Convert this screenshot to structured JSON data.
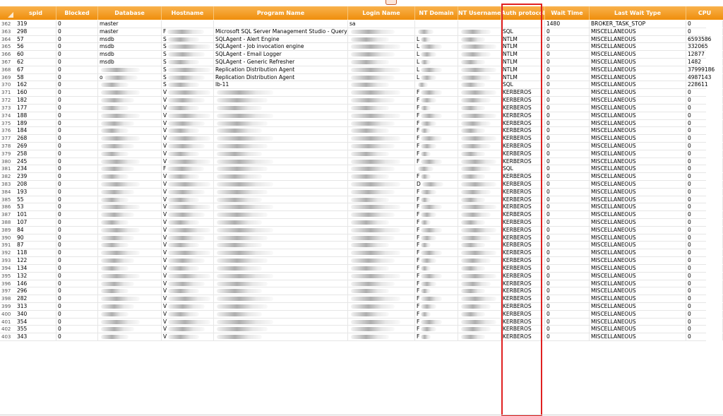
{
  "columns": [
    "spid",
    "Blocked",
    "Database",
    "Hostname",
    "Program Name",
    "Login Name",
    "NT Domain",
    "NT Username",
    "Auth protocol",
    "Wait Time",
    "Last Wait Type",
    "CPU"
  ],
  "rows": [
    {
      "n": "362",
      "spid": "319",
      "blocked": "0",
      "db": "master",
      "host": "",
      "prog": "",
      "login": "sa",
      "domain": "",
      "user": "",
      "auth": "",
      "wait": "1480",
      "wtype": "BROKER_TASK_STOP",
      "cpu": "0"
    },
    {
      "n": "363",
      "spid": "298",
      "blocked": "0",
      "db": "master",
      "host": "F",
      "prog": "Microsoft SQL Server Management Studio - Query",
      "login": "",
      "domain": "",
      "user": "",
      "auth": "SQL",
      "wait": "0",
      "wtype": "MISCELLANEOUS",
      "cpu": "0"
    },
    {
      "n": "364",
      "spid": "57",
      "blocked": "0",
      "db": "msdb",
      "host": "S",
      "prog": "SQLAgent - Alert Engine",
      "login": "",
      "domain": "L",
      "user": "",
      "auth": "NTLM",
      "wait": "0",
      "wtype": "MISCELLANEOUS",
      "cpu": "6593586"
    },
    {
      "n": "365",
      "spid": "56",
      "blocked": "0",
      "db": "msdb",
      "host": "S",
      "prog": "SQLAgent - Job invocation engine",
      "login": "",
      "domain": "L",
      "user": "",
      "auth": "NTLM",
      "wait": "0",
      "wtype": "MISCELLANEOUS",
      "cpu": "332065"
    },
    {
      "n": "366",
      "spid": "60",
      "blocked": "0",
      "db": "msdb",
      "host": "S",
      "prog": "SQLAgent - Email Logger",
      "login": "",
      "domain": "L",
      "user": "",
      "auth": "NTLM",
      "wait": "0",
      "wtype": "MISCELLANEOUS",
      "cpu": "12877"
    },
    {
      "n": "367",
      "spid": "62",
      "blocked": "0",
      "db": "msdb",
      "host": "S",
      "prog": "SQLAgent - Generic Refresher",
      "login": "",
      "domain": "L",
      "user": "",
      "auth": "NTLM",
      "wait": "0",
      "wtype": "MISCELLANEOUS",
      "cpu": "1482"
    },
    {
      "n": "368",
      "spid": "67",
      "blocked": "0",
      "db": "",
      "host": "S",
      "prog": "Replication Distribution Agent",
      "login": "",
      "domain": "L",
      "user": "",
      "auth": "NTLM",
      "wait": "0",
      "wtype": "MISCELLANEOUS",
      "cpu": "37999186"
    },
    {
      "n": "369",
      "spid": "58",
      "blocked": "0",
      "db": "o",
      "host": "S",
      "prog": "Replication Distribution Agent",
      "login": "",
      "domain": "L",
      "user": "",
      "auth": "NTLM",
      "wait": "0",
      "wtype": "MISCELLANEOUS",
      "cpu": "4987143"
    },
    {
      "n": "370",
      "spid": "162",
      "blocked": "0",
      "db": "",
      "host": "S",
      "prog": "Ib-11",
      "login": "",
      "domain": "",
      "user": "",
      "auth": "SQL",
      "wait": "0",
      "wtype": "MISCELLANEOUS",
      "cpu": "228611"
    },
    {
      "n": "371",
      "spid": "160",
      "blocked": "0",
      "db": "",
      "host": "V",
      "prog": "",
      "login": "",
      "domain": "F",
      "user": "",
      "auth": "KERBEROS",
      "wait": "0",
      "wtype": "MISCELLANEOUS",
      "cpu": "0"
    },
    {
      "n": "372",
      "spid": "182",
      "blocked": "0",
      "db": "",
      "host": "V",
      "prog": "",
      "login": "",
      "domain": "F",
      "user": "",
      "auth": "KERBEROS",
      "wait": "0",
      "wtype": "MISCELLANEOUS",
      "cpu": "0"
    },
    {
      "n": "373",
      "spid": "177",
      "blocked": "0",
      "db": "",
      "host": "V",
      "prog": "",
      "login": "",
      "domain": "F",
      "user": "",
      "auth": "KERBEROS",
      "wait": "0",
      "wtype": "MISCELLANEOUS",
      "cpu": "0"
    },
    {
      "n": "374",
      "spid": "188",
      "blocked": "0",
      "db": "",
      "host": "V",
      "prog": "",
      "login": "",
      "domain": "F",
      "user": "",
      "auth": "KERBEROS",
      "wait": "0",
      "wtype": "MISCELLANEOUS",
      "cpu": "0"
    },
    {
      "n": "375",
      "spid": "189",
      "blocked": "0",
      "db": "",
      "host": "V",
      "prog": "",
      "login": "",
      "domain": "F",
      "user": "",
      "auth": "KERBEROS",
      "wait": "0",
      "wtype": "MISCELLANEOUS",
      "cpu": "0"
    },
    {
      "n": "376",
      "spid": "184",
      "blocked": "0",
      "db": "",
      "host": "V",
      "prog": "",
      "login": "",
      "domain": "F",
      "user": "",
      "auth": "KERBEROS",
      "wait": "0",
      "wtype": "MISCELLANEOUS",
      "cpu": "0"
    },
    {
      "n": "377",
      "spid": "268",
      "blocked": "0",
      "db": "",
      "host": "V",
      "prog": "",
      "login": "",
      "domain": "F",
      "user": "",
      "auth": "KERBEROS",
      "wait": "0",
      "wtype": "MISCELLANEOUS",
      "cpu": "0"
    },
    {
      "n": "378",
      "spid": "269",
      "blocked": "0",
      "db": "",
      "host": "V",
      "prog": "",
      "login": "",
      "domain": "F",
      "user": "",
      "auth": "KERBEROS",
      "wait": "0",
      "wtype": "MISCELLANEOUS",
      "cpu": "0"
    },
    {
      "n": "379",
      "spid": "258",
      "blocked": "0",
      "db": "",
      "host": "V",
      "prog": "",
      "login": "",
      "domain": "F",
      "user": "",
      "auth": "KERBEROS",
      "wait": "0",
      "wtype": "MISCELLANEOUS",
      "cpu": "0"
    },
    {
      "n": "380",
      "spid": "245",
      "blocked": "0",
      "db": "",
      "host": "V",
      "prog": "",
      "login": "",
      "domain": "F",
      "user": "",
      "auth": "KERBEROS",
      "wait": "0",
      "wtype": "MISCELLANEOUS",
      "cpu": "0"
    },
    {
      "n": "381",
      "spid": "234",
      "blocked": "0",
      "db": "",
      "host": "F",
      "prog": "",
      "login": "",
      "domain": "",
      "user": "",
      "auth": "SQL",
      "wait": "0",
      "wtype": "MISCELLANEOUS",
      "cpu": "0"
    },
    {
      "n": "382",
      "spid": "239",
      "blocked": "0",
      "db": "",
      "host": "V",
      "prog": "",
      "login": "",
      "domain": "F",
      "user": "",
      "auth": "KERBEROS",
      "wait": "0",
      "wtype": "MISCELLANEOUS",
      "cpu": "0"
    },
    {
      "n": "383",
      "spid": "208",
      "blocked": "0",
      "db": "",
      "host": "V",
      "prog": "",
      "login": "",
      "domain": "D",
      "user": "",
      "auth": "KERBEROS",
      "wait": "0",
      "wtype": "MISCELLANEOUS",
      "cpu": "0"
    },
    {
      "n": "384",
      "spid": "193",
      "blocked": "0",
      "db": "",
      "host": "V",
      "prog": "",
      "login": "",
      "domain": "F",
      "user": "",
      "auth": "KERBEROS",
      "wait": "0",
      "wtype": "MISCELLANEOUS",
      "cpu": "0"
    },
    {
      "n": "385",
      "spid": "55",
      "blocked": "0",
      "db": "",
      "host": "V",
      "prog": "",
      "login": "",
      "domain": "F",
      "user": "",
      "auth": "KERBEROS",
      "wait": "0",
      "wtype": "MISCELLANEOUS",
      "cpu": "0"
    },
    {
      "n": "386",
      "spid": "53",
      "blocked": "0",
      "db": "",
      "host": "V",
      "prog": "",
      "login": "",
      "domain": "F",
      "user": "",
      "auth": "KERBEROS",
      "wait": "0",
      "wtype": "MISCELLANEOUS",
      "cpu": "0"
    },
    {
      "n": "387",
      "spid": "101",
      "blocked": "0",
      "db": "",
      "host": "V",
      "prog": "",
      "login": "",
      "domain": "F",
      "user": "",
      "auth": "KERBEROS",
      "wait": "0",
      "wtype": "MISCELLANEOUS",
      "cpu": "0"
    },
    {
      "n": "388",
      "spid": "107",
      "blocked": "0",
      "db": "",
      "host": "V",
      "prog": "",
      "login": "",
      "domain": "F",
      "user": "",
      "auth": "KERBEROS",
      "wait": "0",
      "wtype": "MISCELLANEOUS",
      "cpu": "0"
    },
    {
      "n": "389",
      "spid": "84",
      "blocked": "0",
      "db": "",
      "host": "V",
      "prog": "",
      "login": "",
      "domain": "F",
      "user": "",
      "auth": "KERBEROS",
      "wait": "0",
      "wtype": "MISCELLANEOUS",
      "cpu": "0"
    },
    {
      "n": "390",
      "spid": "90",
      "blocked": "0",
      "db": "",
      "host": "V",
      "prog": "",
      "login": "",
      "domain": "F",
      "user": "",
      "auth": "KERBEROS",
      "wait": "0",
      "wtype": "MISCELLANEOUS",
      "cpu": "0"
    },
    {
      "n": "391",
      "spid": "87",
      "blocked": "0",
      "db": "",
      "host": "V",
      "prog": "",
      "login": "",
      "domain": "F",
      "user": "",
      "auth": "KERBEROS",
      "wait": "0",
      "wtype": "MISCELLANEOUS",
      "cpu": "0"
    },
    {
      "n": "392",
      "spid": "118",
      "blocked": "0",
      "db": "",
      "host": "V",
      "prog": "",
      "login": "",
      "domain": "F",
      "user": "",
      "auth": "KERBEROS",
      "wait": "0",
      "wtype": "MISCELLANEOUS",
      "cpu": "0"
    },
    {
      "n": "393",
      "spid": "122",
      "blocked": "0",
      "db": "",
      "host": "V",
      "prog": "",
      "login": "",
      "domain": "F",
      "user": "",
      "auth": "KERBEROS",
      "wait": "0",
      "wtype": "MISCELLANEOUS",
      "cpu": "0"
    },
    {
      "n": "394",
      "spid": "134",
      "blocked": "0",
      "db": "",
      "host": "V",
      "prog": "",
      "login": "",
      "domain": "F",
      "user": "",
      "auth": "KERBEROS",
      "wait": "0",
      "wtype": "MISCELLANEOUS",
      "cpu": "0"
    },
    {
      "n": "395",
      "spid": "132",
      "blocked": "0",
      "db": "",
      "host": "V",
      "prog": "",
      "login": "",
      "domain": "F",
      "user": "",
      "auth": "KERBEROS",
      "wait": "0",
      "wtype": "MISCELLANEOUS",
      "cpu": "0"
    },
    {
      "n": "396",
      "spid": "146",
      "blocked": "0",
      "db": "",
      "host": "V",
      "prog": "",
      "login": "",
      "domain": "F",
      "user": "",
      "auth": "KERBEROS",
      "wait": "0",
      "wtype": "MISCELLANEOUS",
      "cpu": "0"
    },
    {
      "n": "397",
      "spid": "296",
      "blocked": "0",
      "db": "",
      "host": "V",
      "prog": "",
      "login": "",
      "domain": "F",
      "user": "",
      "auth": "KERBEROS",
      "wait": "0",
      "wtype": "MISCELLANEOUS",
      "cpu": "0"
    },
    {
      "n": "398",
      "spid": "282",
      "blocked": "0",
      "db": "",
      "host": "V",
      "prog": "",
      "login": "",
      "domain": "F",
      "user": "",
      "auth": "KERBEROS",
      "wait": "0",
      "wtype": "MISCELLANEOUS",
      "cpu": "0"
    },
    {
      "n": "399",
      "spid": "313",
      "blocked": "0",
      "db": "",
      "host": "V",
      "prog": "",
      "login": "",
      "domain": "F",
      "user": "",
      "auth": "KERBEROS",
      "wait": "0",
      "wtype": "MISCELLANEOUS",
      "cpu": "0"
    },
    {
      "n": "400",
      "spid": "340",
      "blocked": "0",
      "db": "",
      "host": "V",
      "prog": "",
      "login": "",
      "domain": "F",
      "user": "",
      "auth": "KERBEROS",
      "wait": "0",
      "wtype": "MISCELLANEOUS",
      "cpu": "0"
    },
    {
      "n": "401",
      "spid": "354",
      "blocked": "0",
      "db": "",
      "host": "V",
      "prog": "",
      "login": "",
      "domain": "F",
      "user": "",
      "auth": "KERBEROS",
      "wait": "0",
      "wtype": "MISCELLANEOUS",
      "cpu": "0"
    },
    {
      "n": "402",
      "spid": "355",
      "blocked": "0",
      "db": "",
      "host": "V",
      "prog": "",
      "login": "",
      "domain": "F",
      "user": "",
      "auth": "KERBEROS",
      "wait": "0",
      "wtype": "MISCELLANEOUS",
      "cpu": "0"
    },
    {
      "n": "403",
      "spid": "343",
      "blocked": "0",
      "db": "",
      "host": "V",
      "prog": "",
      "login": "",
      "domain": "F",
      "user": "",
      "auth": "KERBEROS",
      "wait": "0",
      "wtype": "MISCELLANEOUS",
      "cpu": "0"
    }
  ],
  "colors": {
    "header_top": "#f9b24d",
    "header_bottom": "#ef8e0b",
    "highlight_box": "#e02020"
  },
  "icons": {
    "corner": "select-all-triangle-icon",
    "top": "collapse-tab-icon"
  }
}
